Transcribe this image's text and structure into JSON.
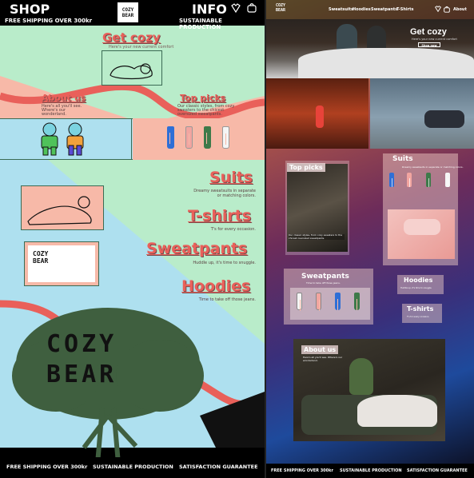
{
  "left": {
    "header": {
      "shop": "SHOP",
      "info": "INFO",
      "shipping": "FREE SHIPPING OVER 300kr",
      "sustainable": "SUSTAINABLE PRODUCTION",
      "logo": "COZY BEAR"
    },
    "get_cozy": {
      "title": "Get cozy",
      "subtitle": "Here's your new current comfort"
    },
    "about": {
      "title": "About us",
      "text": "Here's all you'll see. Where's our wonderland."
    },
    "top_picks": {
      "title": "Top picks",
      "text": "Our classic styles, from cozy sweaters to the chicest oversized sweatpants."
    },
    "suits": {
      "title": "Suits",
      "text": "Dreamy sweatsuits in separate or matching colors."
    },
    "tshirts": {
      "title": "T-shirts",
      "text": "T's for every occasion."
    },
    "sweatpants": {
      "title": "Sweatpants",
      "text": "Huddle up, it's time to snuggle."
    },
    "hoodies": {
      "title": "Hoodies",
      "text": "Time to take off those jeans."
    },
    "tree_text": "COZY BEAR",
    "footer": {
      "shipping": "FREE SHIPPING OVER 300kr",
      "sustainable": "SUSTAINABLE PRODUCTION",
      "satisfaction": "SATISFACTION GUARANTEE"
    }
  },
  "right": {
    "logo": "COZY BEAR",
    "nav": [
      "Sweatsuits",
      "Hoodies",
      "Sweatpants",
      "T-Shirts"
    ],
    "about_link": "About",
    "hero": {
      "title": "Get cozy",
      "subtitle": "Here's your new current comfort",
      "button": "Shop now"
    },
    "top_picks": {
      "title": "Top picks",
      "caption": "Our classic styles, from cozy sweaters to the chicest oversized sweatpants."
    },
    "suits": {
      "title": "Suits",
      "text": "Dreamy sweatsuits in separate or matching colors."
    },
    "sweatpants": {
      "title": "Sweatpants",
      "text": "Time to take off those jeans."
    },
    "hoodies": {
      "title": "Hoodies",
      "text": "Huddle up, it's time to snuggle."
    },
    "tshirts": {
      "title": "T-shirts",
      "text": "T's for every occasion."
    },
    "about": {
      "title": "About us",
      "text": "Here's all you'll see. Where's our wonderland."
    },
    "footer": {
      "shipping": "FREE SHIPPING OVER 300kr",
      "sustainable": "SUSTAINABLE PRODUCTION",
      "satisfaction": "SATISFACTION GUARANTEE"
    }
  },
  "colors": {
    "mint": "#b9ecca",
    "sky": "#aee0ef",
    "peach": "#f7b9a8",
    "rose": "#e9605a",
    "tree": "#3f5f3f",
    "header_bg": "#000000"
  },
  "icons": [
    "heart-icon",
    "bag-icon"
  ]
}
